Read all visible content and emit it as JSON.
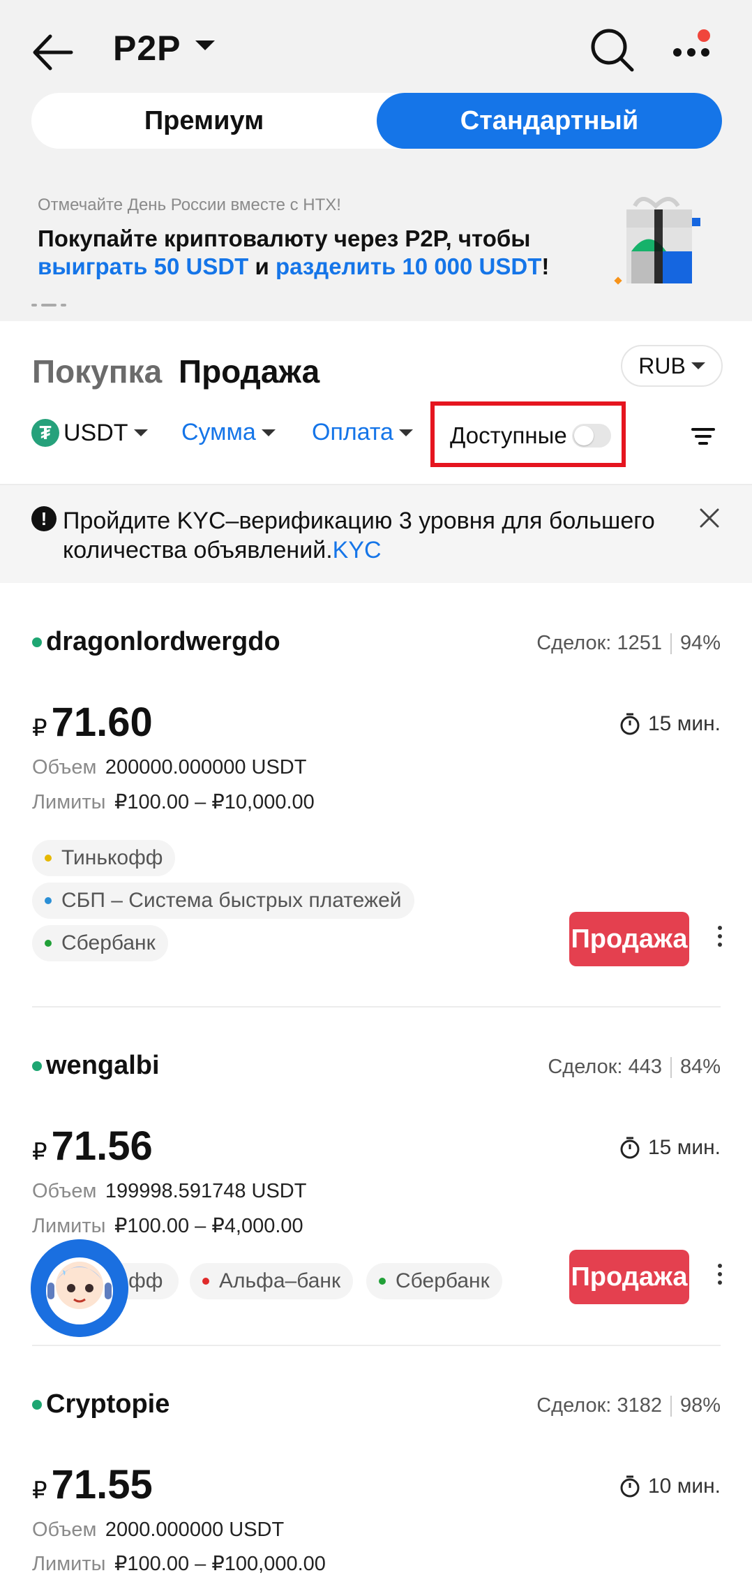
{
  "header": {
    "title": "P2P",
    "back_icon": "arrow-left-icon",
    "search_icon": "search-icon",
    "more_icon": "more-dots-icon"
  },
  "mode_tabs": {
    "premium": "Премиум",
    "standard": "Стандартный",
    "active": "standard"
  },
  "banner": {
    "small": "Отмечайте День России вместе с HTX!",
    "line1": "Покупайте криптовалюту через P2P, чтобы",
    "win": "выиграть 50 USDT",
    "and": " и ",
    "share": "разделить 10 000 USDT",
    "bang": "!"
  },
  "side_tabs": {
    "buy": "Покупка",
    "sell": "Продажа",
    "active": "sell"
  },
  "fiat": "RUB",
  "filters": {
    "coin": "USDT",
    "amount": "Сумма",
    "payment": "Оплата",
    "available": "Доступные",
    "available_on": false
  },
  "kyc": {
    "text": "Пройдите KYC–верификацию 3 уровня для большего количества объявлений.",
    "link": "KYC"
  },
  "labels": {
    "deals": "Сделок:",
    "volume": "Объем",
    "limits": "Лимиты",
    "sell_button": "Продажа"
  },
  "colors": {
    "accent": "#1575e8",
    "sell": "#e4404f",
    "online": "#1ea672",
    "highlight": "#e5151f"
  },
  "listings": [
    {
      "merchant": "dragonlordwergdo",
      "deals": "1251",
      "rate": "94%",
      "currency_sign": "₽",
      "price": "71.60",
      "time": "15 мин.",
      "volume": "200000.000000 USDT",
      "limits": "₽100.00 – ₽10,000.00",
      "payments": [
        {
          "name": "Тинькофф",
          "color": "#e6b800"
        },
        {
          "name": "СБП – Система быстрых платежей",
          "color": "#2a8fd6"
        },
        {
          "name": "Сбербанк",
          "color": "#21a038"
        }
      ]
    },
    {
      "merchant": "wengalbi",
      "deals": "443",
      "rate": "84%",
      "currency_sign": "₽",
      "price": "71.56",
      "time": "15 мин.",
      "volume": "199998.591748 USDT",
      "limits": "₽100.00 – ₽4,000.00",
      "payments": [
        {
          "name": "Тинькофф",
          "color": "#e6b800"
        },
        {
          "name": "Альфа–банк",
          "color": "#e02b2b"
        },
        {
          "name": "Сбербанк",
          "color": "#21a038"
        }
      ]
    },
    {
      "merchant": "Cryptopie",
      "deals": "3182",
      "rate": "98%",
      "currency_sign": "₽",
      "price": "71.55",
      "time": "10 мин.",
      "volume": "2000.000000 USDT",
      "limits": "₽100.00 – ₽100,000.00"
    }
  ]
}
